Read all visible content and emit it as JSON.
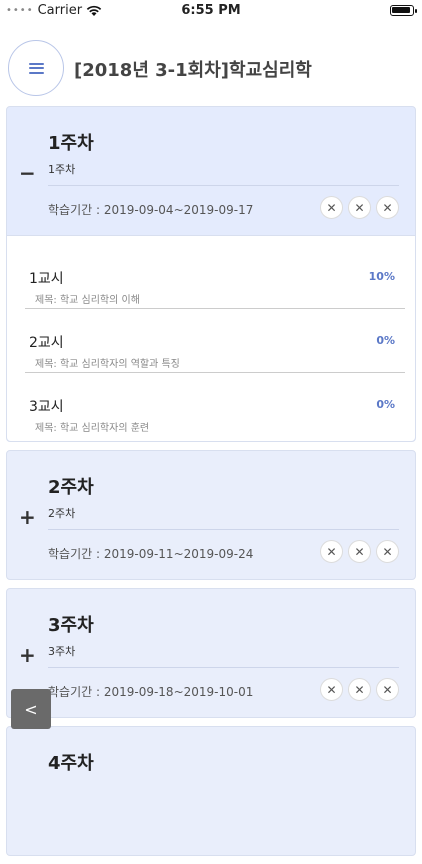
{
  "status": {
    "carrier": "Carrier",
    "time": "6:55 PM"
  },
  "header": {
    "title": "[2018년 3-1회차]학교심리학"
  },
  "weeks": [
    {
      "title": "1주차",
      "subtitle": "1주차",
      "period": "학습기간 : 2019-09-04~2019-09-17",
      "toggle": "−"
    },
    {
      "title": "2주차",
      "subtitle": "2주차",
      "period": "학습기간 : 2019-09-11~2019-09-24",
      "toggle": "+"
    },
    {
      "title": "3주차",
      "subtitle": "3주차",
      "period": "학습기간 : 2019-09-18~2019-10-01",
      "toggle": "+"
    },
    {
      "title": "4주차"
    }
  ],
  "lessons": [
    {
      "title": "1교시",
      "percent": "10%",
      "subject": "제목: 학교 심리학의 이해"
    },
    {
      "title": "2교시",
      "percent": "0%",
      "subject": "제목: 학교 심리학자의 역할과 특징"
    },
    {
      "title": "3교시",
      "percent": "0%",
      "subject": "제목: 학교 심리학자의 훈련"
    }
  ],
  "x_glyph": "✕",
  "back_label": "<",
  "colors": {
    "accent": "#5b78c7",
    "card_bg": "#e9eefb"
  }
}
